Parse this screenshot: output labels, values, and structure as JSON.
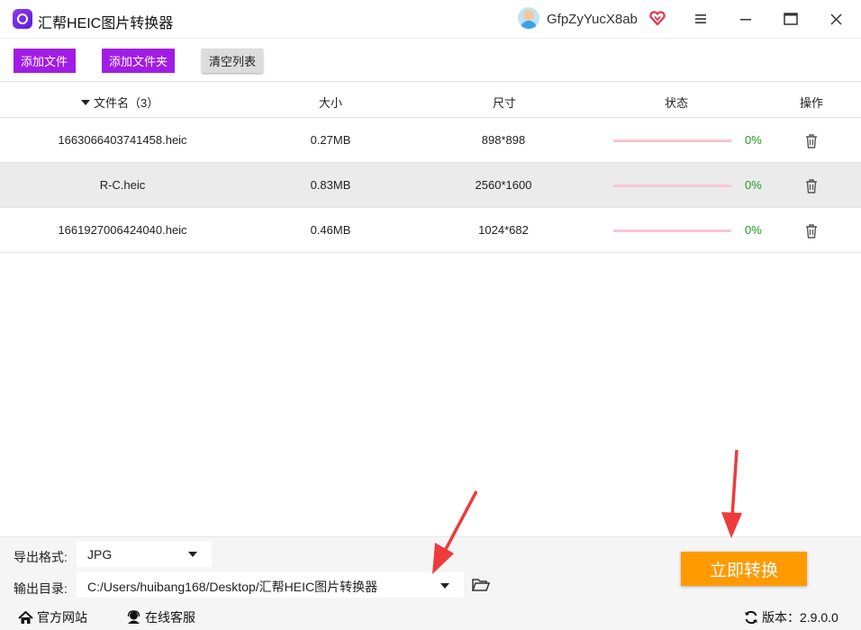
{
  "app": {
    "title": "汇帮HEIC图片转换器",
    "user_name": "GfpZyYucX8ab",
    "icons": [
      "app-logo-icon",
      "avatar",
      "vip-heart-icon",
      "menu-icon",
      "minimize-icon",
      "maximize-icon",
      "close-icon"
    ]
  },
  "toolbar": {
    "add_file": "添加文件",
    "add_folder": "添加文件夹",
    "clear_list": "清空列表"
  },
  "table": {
    "headers": {
      "name": "文件名（3）",
      "size": "大小",
      "dimensions": "尺寸",
      "status": "状态",
      "action": "操作"
    },
    "rows": [
      {
        "name": "1663066403741458.heic",
        "size": "0.27MB",
        "dimensions": "898*898",
        "progress": 0,
        "percent": "0%"
      },
      {
        "name": "R-C.heic",
        "size": "0.83MB",
        "dimensions": "2560*1600",
        "progress": 0,
        "percent": "0%"
      },
      {
        "name": "1661927006424040.heic",
        "size": "0.46MB",
        "dimensions": "1024*682",
        "progress": 0,
        "percent": "0%"
      }
    ]
  },
  "settings": {
    "format_label": "导出格式:",
    "format_value": "JPG",
    "dir_label": "输出目录:",
    "dir_value": "C:/Users/huibang168/Desktop/汇帮HEIC图片转换器",
    "convert_button": "立即转换"
  },
  "footer": {
    "site": "官方网站",
    "service": "在线客服",
    "version": "版本：2.9.0.0"
  },
  "colors": {
    "purple_button": "#a11de5",
    "convert_orange": "#ff9b00",
    "progress_track": "#f7c6d3",
    "percent_green": "#1a9a22",
    "annotation_red": "#ee3b3b"
  }
}
